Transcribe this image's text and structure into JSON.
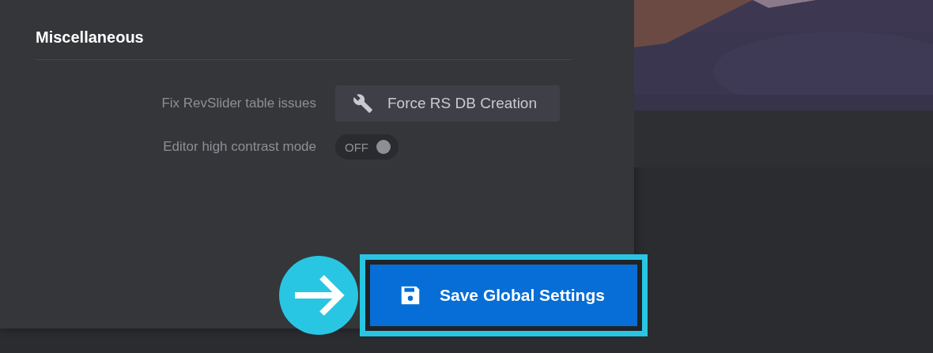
{
  "section": {
    "title": "Miscellaneous"
  },
  "settings": [
    {
      "kind": "button",
      "label": "Fix RevSlider table issues",
      "button_label": "Force RS DB Creation"
    },
    {
      "kind": "toggle",
      "label": "Editor high contrast mode",
      "on": false,
      "state_text": "OFF"
    }
  ],
  "save_button": {
    "label": "Save Global Settings",
    "highlighted": true
  }
}
